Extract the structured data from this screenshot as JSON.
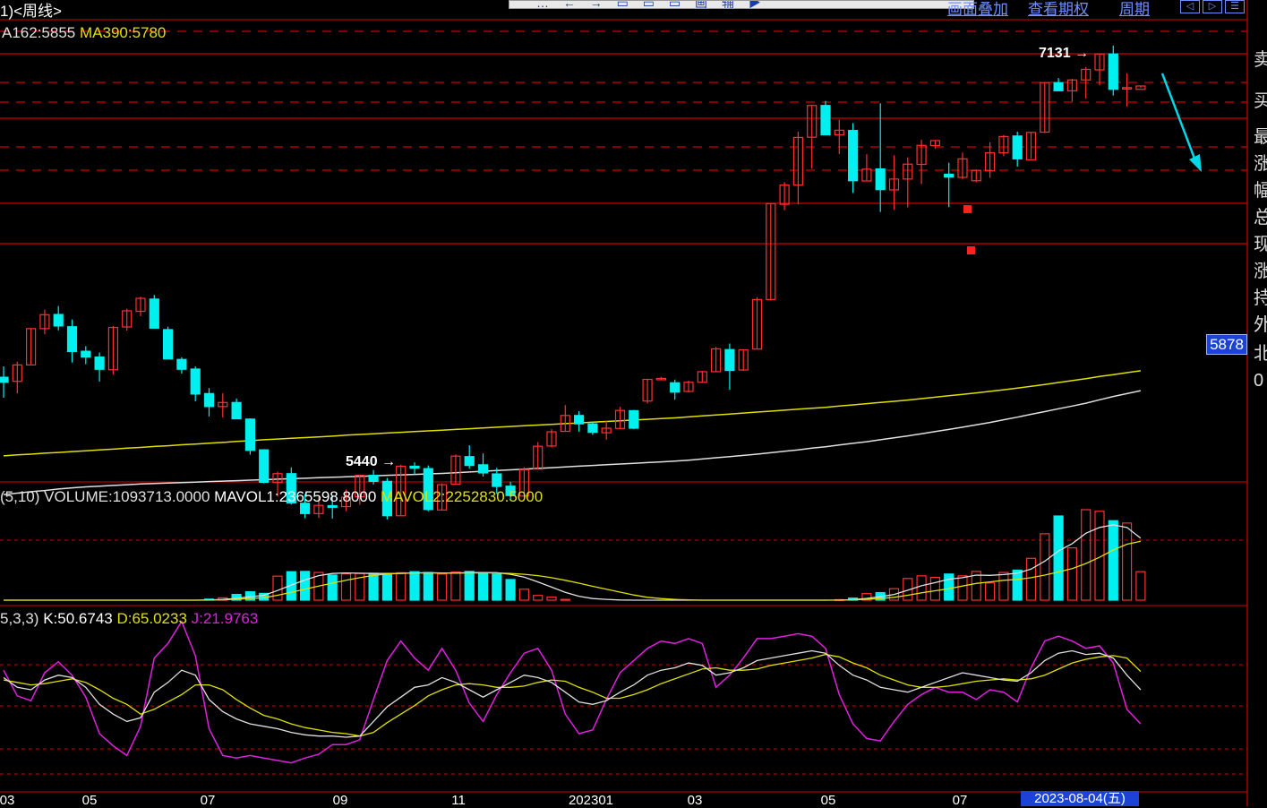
{
  "header": {
    "title": "1)<周线>",
    "links": [
      {
        "label": "画面叠加"
      },
      {
        "label": "查看期权"
      },
      {
        "label": "周期"
      }
    ],
    "toolbar_glyphs": "… ← → ▭ ▭ ▭ 画 辅 ▶"
  },
  "main_legend": {
    "ma162": "A162:5855",
    "ma390": "MA390:5780"
  },
  "volume_legend": {
    "prefix": "(5,10)",
    "volume": "VOLUME:1093713.0000",
    "mavol1": "MAVOL1:2365598.8000",
    "mavol2": "MAVOL2:2252830.5000"
  },
  "kdj_legend": {
    "prefix": "5,3,3)",
    "k": "K:50.6743",
    "d": "D:65.0233",
    "j": "J:21.9763"
  },
  "annotations": {
    "high_label": "7131",
    "low_label": "5440",
    "current_price": "5878"
  },
  "side_panel": {
    "chars": [
      "卖",
      "买",
      "最",
      "涨",
      "幅",
      "总",
      "现",
      "涨",
      "持",
      "外",
      "北",
      "0"
    ]
  },
  "x_axis": {
    "labels": [
      "03",
      "05",
      "07",
      "09",
      "11",
      "202301",
      "03",
      "05",
      "07"
    ],
    "cursor_date": "2023-08-04(五)"
  },
  "colors": {
    "up": "#ff3030",
    "down": "#00f0f0",
    "grid_red": "#d00000",
    "ma_white": "#e0e0e0",
    "ma_yellow": "#e0e000",
    "j_line": "#e020e0",
    "price_tag": "#1b43d6"
  },
  "chart_data": {
    "type": "candlestick",
    "ohlc": [
      [
        5786,
        5831,
        5701,
        5765
      ],
      [
        5769,
        5851,
        5719,
        5837
      ],
      [
        5837,
        5990,
        5836,
        5988
      ],
      [
        5988,
        6067,
        5965,
        6046
      ],
      [
        6047,
        6082,
        5981,
        5999
      ],
      [
        5996,
        6026,
        5847,
        5893
      ],
      [
        5894,
        5915,
        5840,
        5870
      ],
      [
        5870,
        5889,
        5768,
        5819
      ],
      [
        5817,
        5999,
        5797,
        5993
      ],
      [
        5995,
        6071,
        5980,
        6062
      ],
      [
        6060,
        6121,
        6040,
        6114
      ],
      [
        6111,
        6128,
        5990,
        5990
      ],
      [
        5984,
        5996,
        5863,
        5862
      ],
      [
        5860,
        5869,
        5801,
        5819
      ],
      [
        5820,
        5831,
        5686,
        5716
      ],
      [
        5718,
        5741,
        5623,
        5664
      ],
      [
        5664,
        5719,
        5619,
        5681
      ],
      [
        5681,
        5697,
        5612,
        5613
      ],
      [
        5612,
        5615,
        5464,
        5482
      ],
      [
        5484,
        5487,
        5345,
        5349
      ],
      [
        5348,
        5393,
        5290,
        5385
      ],
      [
        5385,
        5411,
        5257,
        5263
      ],
      [
        5262,
        5300,
        5200,
        5219
      ],
      [
        5219,
        5288,
        5201,
        5253
      ],
      [
        5252,
        5294,
        5198,
        5245
      ],
      [
        5248,
        5319,
        5229,
        5287
      ],
      [
        5289,
        5381,
        5256,
        5378
      ],
      [
        5378,
        5400,
        5340,
        5353
      ],
      [
        5353,
        5367,
        5195,
        5210
      ],
      [
        5210,
        5422,
        5212,
        5416
      ],
      [
        5416,
        5432,
        5382,
        5408
      ],
      [
        5406,
        5419,
        5229,
        5236
      ],
      [
        5234,
        5345,
        5233,
        5339
      ],
      [
        5341,
        5465,
        5341,
        5458
      ],
      [
        5456,
        5503,
        5406,
        5419
      ],
      [
        5422,
        5469,
        5373,
        5388
      ],
      [
        5384,
        5409,
        5301,
        5332
      ],
      [
        5333,
        5352,
        5278,
        5294
      ],
      [
        5292,
        5412,
        5291,
        5402
      ],
      [
        5404,
        5516,
        5404,
        5499
      ],
      [
        5500,
        5570,
        5494,
        5559
      ],
      [
        5561,
        5670,
        5559,
        5627
      ],
      [
        5627,
        5645,
        5560,
        5592
      ],
      [
        5592,
        5601,
        5546,
        5557
      ],
      [
        5555,
        5604,
        5526,
        5574
      ],
      [
        5573,
        5663,
        5573,
        5648
      ],
      [
        5647,
        5650,
        5570,
        5574
      ],
      [
        5687,
        5780,
        5677,
        5777
      ],
      [
        5777,
        5787,
        5776,
        5781
      ],
      [
        5763,
        5776,
        5693,
        5724
      ],
      [
        5727,
        5772,
        5723,
        5765
      ],
      [
        5765,
        5812,
        5763,
        5809
      ],
      [
        5809,
        5912,
        5808,
        5904
      ],
      [
        5901,
        5926,
        5734,
        5814
      ],
      [
        5816,
        5902,
        5813,
        5900
      ],
      [
        5903,
        6119,
        5902,
        6109
      ],
      [
        6109,
        6509,
        6105,
        6508
      ],
      [
        6505,
        6597,
        6480,
        6585
      ],
      [
        6585,
        6807,
        6505,
        6783
      ],
      [
        6784,
        6915,
        6653,
        6916
      ],
      [
        6916,
        6935,
        6804,
        6794
      ],
      [
        6794,
        6857,
        6714,
        6813
      ],
      [
        6812,
        6843,
        6552,
        6603
      ],
      [
        6602,
        6713,
        6605,
        6651
      ],
      [
        6652,
        6925,
        6473,
        6566
      ],
      [
        6565,
        6709,
        6482,
        6610
      ],
      [
        6610,
        6700,
        6492,
        6672
      ],
      [
        6671,
        6774,
        6589,
        6750
      ],
      [
        6749,
        6771,
        6737,
        6770
      ],
      [
        6630,
        6678,
        6493,
        6618
      ],
      [
        6617,
        6720,
        6608,
        6694
      ],
      [
        6603,
        6650,
        6597,
        6646
      ],
      [
        6644,
        6763,
        6615,
        6719
      ],
      [
        6719,
        6793,
        6705,
        6787
      ],
      [
        6789,
        6807,
        6662,
        6694
      ],
      [
        6690,
        6805,
        6695,
        6804
      ],
      [
        6805,
        7012,
        6802,
        7011
      ],
      [
        7011,
        7030,
        6977,
        6977
      ],
      [
        6977,
        7027,
        6933,
        7022
      ],
      [
        7022,
        7076,
        6944,
        7066
      ],
      [
        7064,
        7132,
        7000,
        7130
      ],
      [
        7130,
        7165,
        6957,
        6983
      ],
      [
        6989,
        7050,
        6912,
        6990
      ],
      [
        6983,
        6997,
        6989,
        6997
      ]
    ],
    "ma162": [
      5459,
      5463,
      5466,
      5470,
      5473,
      5477,
      5480,
      5484,
      5487,
      5491,
      5494,
      5498,
      5501,
      5505,
      5508,
      5512,
      5515,
      5519,
      5522,
      5526,
      5529,
      5532,
      5535,
      5538,
      5541,
      5545,
      5548,
      5551,
      5554,
      5557,
      5560,
      5563,
      5566,
      5569,
      5572,
      5575,
      5578,
      5581,
      5584,
      5587,
      5590,
      5593,
      5596,
      5599,
      5602,
      5605,
      5608,
      5611,
      5614,
      5617,
      5621,
      5625,
      5629,
      5633,
      5637,
      5641,
      5645,
      5649,
      5653,
      5657,
      5661,
      5666,
      5671,
      5676,
      5681,
      5686,
      5691,
      5697,
      5703,
      5709,
      5715,
      5721,
      5727,
      5734,
      5741,
      5748,
      5756,
      5764,
      5772,
      5780,
      5789,
      5797,
      5805,
      5813
    ],
    "ma390": [
      5298,
      5304,
      5310,
      5315,
      5321,
      5326,
      5330,
      5333,
      5336,
      5339,
      5342,
      5344,
      5346,
      5348,
      5350,
      5352,
      5354,
      5356,
      5358,
      5360,
      5362,
      5364,
      5366,
      5368,
      5370,
      5372,
      5374,
      5376,
      5378,
      5380,
      5382,
      5384,
      5386,
      5389,
      5392,
      5395,
      5398,
      5401,
      5404,
      5407,
      5410,
      5413,
      5416,
      5419,
      5422,
      5425,
      5428,
      5431,
      5434,
      5437,
      5441,
      5446,
      5451,
      5456,
      5461,
      5466,
      5472,
      5478,
      5484,
      5491,
      5497,
      5504,
      5511,
      5518,
      5526,
      5534,
      5542,
      5551,
      5560,
      5569,
      5578,
      5588,
      5598,
      5609,
      5620,
      5632,
      5643,
      5655,
      5666,
      5678,
      5692,
      5706,
      5718,
      5730
    ],
    "volume": [
      0,
      0,
      0,
      0,
      0,
      0,
      0,
      0,
      0,
      0,
      0,
      0,
      0,
      0,
      0,
      40000,
      90000,
      220000,
      320000,
      260000,
      920000,
      1090000,
      1100000,
      1060000,
      960000,
      1010000,
      1020000,
      1030000,
      1010000,
      1050000,
      1090000,
      1060000,
      1000000,
      1080000,
      1100000,
      1040000,
      1000000,
      790000,
      420000,
      180000,
      120000,
      30000,
      0,
      0,
      0,
      0,
      0,
      0,
      0,
      0,
      0,
      0,
      0,
      0,
      0,
      0,
      0,
      0,
      0,
      0,
      0,
      20000,
      80000,
      250000,
      290000,
      440000,
      830000,
      930000,
      870000,
      1000000,
      930000,
      1100000,
      660000,
      1060000,
      1150000,
      1600000,
      2540000,
      3220000,
      2000000,
      3460000,
      3400000,
      3040000,
      2950000,
      1090000
    ],
    "mavol1": [
      0,
      0,
      0,
      0,
      0,
      0,
      0,
      0,
      0,
      0,
      0,
      0,
      0,
      0,
      0,
      8000,
      26000,
      70000,
      134000,
      186000,
      370000,
      580000,
      770000,
      940000,
      1020000,
      1040000,
      1030000,
      1020000,
      1020000,
      1020000,
      1040000,
      1050000,
      1040000,
      1040000,
      1060000,
      1060000,
      1050000,
      990000,
      880000,
      700000,
      500000,
      300000,
      150000,
      60000,
      30000,
      6000,
      0,
      0,
      0,
      0,
      0,
      0,
      0,
      0,
      0,
      0,
      0,
      0,
      0,
      0,
      0,
      4000,
      20000,
      70000,
      130000,
      220000,
      380000,
      550000,
      670000,
      800000,
      860000,
      960000,
      950000,
      980000,
      1030000,
      1190000,
      1490000,
      1880000,
      2160000,
      2560000,
      2780000,
      2880000,
      2780000,
      2370000
    ],
    "mavol2": [
      0,
      0,
      0,
      0,
      0,
      0,
      0,
      0,
      0,
      0,
      0,
      0,
      0,
      0,
      0,
      4000,
      13000,
      35000,
      67000,
      93000,
      190000,
      300000,
      420000,
      540000,
      650000,
      760000,
      860000,
      950000,
      1000000,
      1030000,
      1040000,
      1040000,
      1030000,
      1030000,
      1040000,
      1040000,
      1040000,
      1020000,
      990000,
      940000,
      860000,
      760000,
      650000,
      530000,
      420000,
      310000,
      200000,
      110000,
      60000,
      30000,
      10000,
      0,
      0,
      0,
      0,
      0,
      0,
      0,
      0,
      0,
      0,
      2000,
      10000,
      35000,
      65000,
      110000,
      190000,
      280000,
      360000,
      440000,
      540000,
      640000,
      700000,
      760000,
      790000,
      860000,
      960000,
      1080000,
      1210000,
      1400000,
      1640000,
      1920000,
      2140000,
      2250000
    ],
    "kdj_k": [
      60,
      52,
      50,
      58,
      62,
      60,
      52,
      38,
      30,
      24,
      27,
      48,
      56,
      66,
      62,
      42,
      32,
      26,
      22,
      20,
      18,
      15,
      13,
      12,
      12,
      11,
      12,
      24,
      36,
      44,
      52,
      54,
      60,
      56,
      50,
      44,
      50,
      56,
      62,
      60,
      56,
      48,
      40,
      38,
      41,
      48,
      54,
      62,
      66,
      68,
      72,
      70,
      62,
      64,
      68,
      74,
      76,
      78,
      80,
      82,
      80,
      70,
      62,
      58,
      52,
      50,
      48,
      52,
      56,
      60,
      64,
      62,
      60,
      58,
      57,
      64,
      74,
      80,
      82,
      79,
      80,
      76,
      62,
      50
    ],
    "kdj_d": [
      58,
      56,
      54,
      55,
      57,
      59,
      56,
      50,
      43,
      38,
      30,
      34,
      40,
      46,
      54,
      54,
      50,
      42,
      35,
      29,
      26,
      22,
      19,
      17,
      15,
      14,
      12,
      15,
      23,
      30,
      37,
      45,
      50,
      54,
      55,
      54,
      52,
      52,
      53,
      56,
      58,
      57,
      52,
      48,
      43,
      43,
      46,
      50,
      55,
      59,
      63,
      67,
      68,
      66,
      66,
      67,
      70,
      72,
      74,
      76,
      79,
      77,
      72,
      68,
      62,
      58,
      54,
      52,
      52,
      53,
      55,
      57,
      58,
      59,
      58,
      59,
      62,
      67,
      72,
      75,
      77,
      78,
      76,
      65
    ],
    "kdj_j": [
      66,
      45,
      41,
      64,
      73,
      62,
      44,
      14,
      4,
      -4,
      20,
      76,
      88,
      106,
      78,
      18,
      -4,
      -6,
      -4,
      -6,
      -8,
      -10,
      -6,
      -3,
      5,
      5,
      9,
      42,
      74,
      90,
      76,
      66,
      84,
      66,
      39,
      24,
      46,
      64,
      80,
      84,
      66,
      30,
      14,
      17,
      42,
      64,
      74,
      84,
      90,
      88,
      92,
      88,
      52,
      62,
      76,
      92,
      92,
      94,
      96,
      94,
      84,
      46,
      22,
      10,
      8,
      24,
      38,
      46,
      52,
      48,
      48,
      42,
      50,
      48,
      40,
      68,
      90,
      94,
      90,
      84,
      86,
      72,
      34,
      22
    ]
  }
}
